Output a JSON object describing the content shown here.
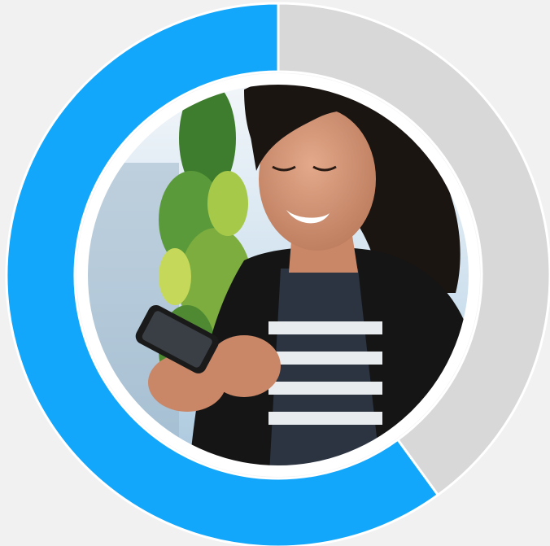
{
  "page": {
    "background": "#f1f1f1"
  },
  "chart_data": {
    "type": "pie",
    "style": "donut",
    "categories": [
      "",
      ""
    ],
    "values": [
      60,
      40
    ],
    "colors": [
      "#12a7fb",
      "#d8d8d8"
    ],
    "start_angle_deg": 0,
    "direction": "counterclockwise",
    "title": "",
    "legend": "none",
    "center_content": "photo"
  },
  "photo": {
    "subject": "",
    "icon": "person-with-phone-photo"
  }
}
